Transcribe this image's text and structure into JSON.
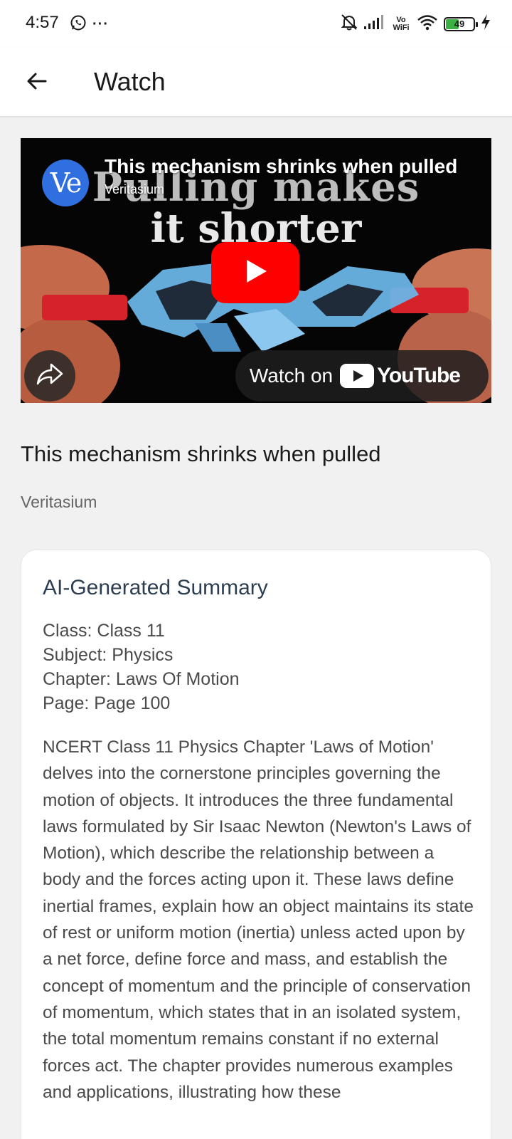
{
  "status_bar": {
    "time": "4:57",
    "more": "···",
    "network": "Vo WiFi",
    "battery": "49",
    "icons": [
      "whatsapp-icon",
      "mute-bell-icon",
      "signal-icon",
      "wifi-icon",
      "battery-icon",
      "charging-icon"
    ]
  },
  "app_bar": {
    "title": "Watch",
    "back_icon": "arrow-left-icon"
  },
  "video": {
    "title": "This mechanism shrinks when pulled",
    "channel": "Veritasium",
    "avatar_text": "Ve",
    "thumbnail_line1": "Pulling makes",
    "thumbnail_line2": "it shorter",
    "watch_on": "Watch on",
    "youtube": "YouTube",
    "accent": "#ff0000"
  },
  "page": {
    "video_title": "This mechanism shrinks when pulled",
    "channel": "Veritasium"
  },
  "summary": {
    "heading": "AI-Generated Summary",
    "class_line": "Class: Class 11",
    "subject_line": "Subject: Physics",
    "chapter_line": "Chapter: Laws Of Motion",
    "page_line": "Page: Page 100",
    "body": "NCERT Class 11 Physics Chapter 'Laws of Motion' delves into the cornerstone principles governing the motion of objects. It introduces the three fundamental laws formulated by Sir Isaac Newton (Newton's Laws of Motion), which describe the relationship between a body and the forces acting upon it. These laws define inertial frames, explain how an object maintains its state of rest or uniform motion (inertia) unless acted upon by a net force, define force and mass, and establish the concept of momentum and the principle of conservation of momentum, which states that in an isolated system, the total momentum remains constant if no external forces act. The chapter provides numerous examples and applications, illustrating how these"
  }
}
